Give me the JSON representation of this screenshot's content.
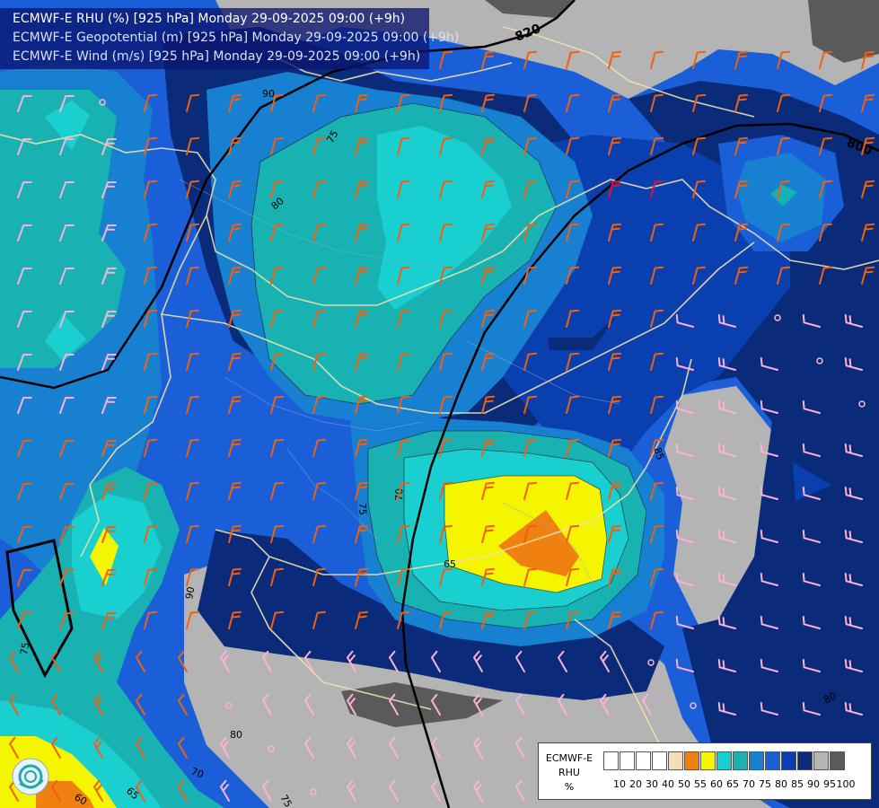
{
  "header": {
    "line1": "ECMWF-E RHU (%) [925 hPa] Monday 29-09-2025 09:00 (+9h)",
    "line2": "ECMWF-E Geopotential (m) [925 hPa] Monday 29-09-2025 09:00 (+9h)",
    "line3": "ECMWF-E Wind (m/s) [925 hPa] Monday 29-09-2025 09:00 (+9h)"
  },
  "geopotential_labels": [
    "820",
    "800"
  ],
  "rhu_labels": [
    "90",
    "75",
    "80",
    "85",
    "70",
    "75",
    "65",
    "90",
    "75",
    "80",
    "80",
    "70",
    "75",
    "65",
    "60",
    "80"
  ],
  "legend": {
    "title_line1": "ECMWF-E",
    "title_line2": "RHU",
    "title_line3": "%",
    "ticks": [
      "10",
      "20",
      "30",
      "40",
      "50",
      "55",
      "60",
      "65",
      "70",
      "75",
      "80",
      "85",
      "90",
      "95",
      "100"
    ],
    "colors": [
      "#ffffff",
      "#ffffff",
      "#ffffff",
      "#ffffff",
      "#f5deb3",
      "#f08010",
      "#f5f500",
      "#1acfcf",
      "#19b2b2",
      "#1780d0",
      "#1a5fd8",
      "#0a3fb0",
      "#0a2a7a",
      "#b4b4b4",
      "#5a5a5a"
    ]
  },
  "colors": {
    "rhu_60": "#f08010",
    "rhu_65": "#f5f500",
    "rhu_70": "#1acfcf",
    "rhu_75": "#19b2b2",
    "rhu_80": "#1780d0",
    "rhu_85": "#1a5fd8",
    "rhu_90": "#0a3fb0",
    "rhu_95": "#0a2a7a",
    "rhu_100": "#b4b4b4",
    "rhu_max": "#5a5a5a",
    "wind_orange": "#f06010",
    "wind_pink": "#ffb0d8",
    "wind_red": "#e01030",
    "wind_white": "#ffffff",
    "border": "#f0e0b0",
    "title_text": "#ffffff"
  }
}
